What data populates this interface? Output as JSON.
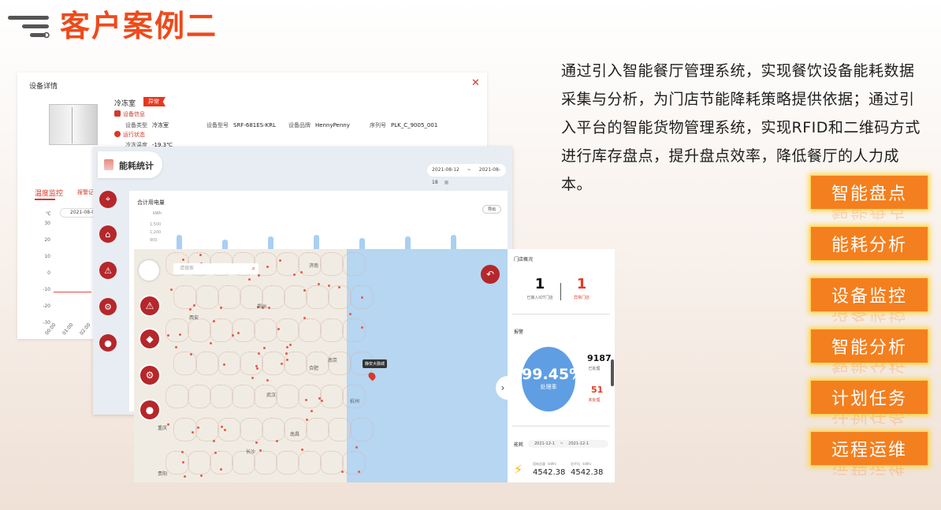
{
  "header": {
    "title": "客户案例二"
  },
  "description": "通过引入智能餐厅管理系统，实现餐饮设备能耗数据采集与分析，为门店节能降耗策略提供依据；通过引入平台的智能货物管理系统，实现RFID和二维码方式进行库存盘点，提升盘点效率，降低餐厅的人力成本。",
  "features": [
    "智能盘点",
    "能耗分析",
    "设备监控",
    "智能分析",
    "计划任务",
    "远程运维"
  ],
  "device_detail": {
    "title": "设备详情",
    "device_name": "冷冻室",
    "status_badge": "异常",
    "section_info": "设备信息",
    "section_run": "运行状态",
    "fields": [
      {
        "label": "设备类型",
        "value": "冷冻室"
      },
      {
        "label": "设备型号",
        "value": "SRF-681ES-KRL"
      },
      {
        "label": "设备品牌",
        "value": "HennyPenny"
      },
      {
        "label": "序列号",
        "value": "PLK_C_9005_001"
      }
    ],
    "freeze_temp_label": "冷冻温度",
    "freeze_temp_value": "-19.3℃",
    "tab_temp": "温度监控",
    "tab_alarm": "报警记录",
    "date": "2021-08-0",
    "unit": "℃",
    "y_ticks": [
      "30",
      "20",
      "10",
      "0",
      "-10",
      "-20",
      "-30"
    ],
    "x_ticks": [
      "00:00",
      "01:00",
      "02:00"
    ]
  },
  "energy_stats": {
    "title": "能耗统计",
    "date_from": "2021-08-12",
    "date_sep": "~",
    "date_to": "2021-08-18",
    "card_title": "合计用电量",
    "card_unit": "kWh",
    "y_ticks": [
      "1,500",
      "1,200",
      "900"
    ],
    "export_label": "导出",
    "bar_levels": [
      0.45,
      0.3,
      0.4,
      0.45,
      0.35,
      0.4,
      0.45
    ]
  },
  "map_view": {
    "search_placeholder": "请搜索",
    "tooltip": "静安大融城",
    "cities": [
      "济南",
      "郑州",
      "西安",
      "合肥",
      "南京",
      "武汉",
      "杭州",
      "长沙",
      "南昌",
      "重庆",
      "贵阳"
    ]
  },
  "store_panel": {
    "title": "门店概况",
    "stat1_value": "1",
    "stat1_label": "已接入IOT门店",
    "stat2_value": "1",
    "stat2_label": "异常门店",
    "alarm_title": "报警",
    "rate_value": "99.45%",
    "rate_label": "处理率",
    "handled_value": "9187",
    "handled_label": "已处理",
    "unhandled_value": "51",
    "unhandled_label": "未处理",
    "energy_title": "能耗",
    "energy_from": "2021-12-1",
    "energy_sep": "~",
    "energy_to": "2021-12-1",
    "energy1_label": "用电总量（kWh）",
    "energy1_value": "4542.38",
    "energy2_label": "总平均（kWh）",
    "energy2_value": "4542.38"
  },
  "colors": {
    "title": "#ee4a1c",
    "feature_bg": "#f47f1f",
    "brand_red": "#b5272a",
    "rate_circle": "#5f9ee3"
  }
}
